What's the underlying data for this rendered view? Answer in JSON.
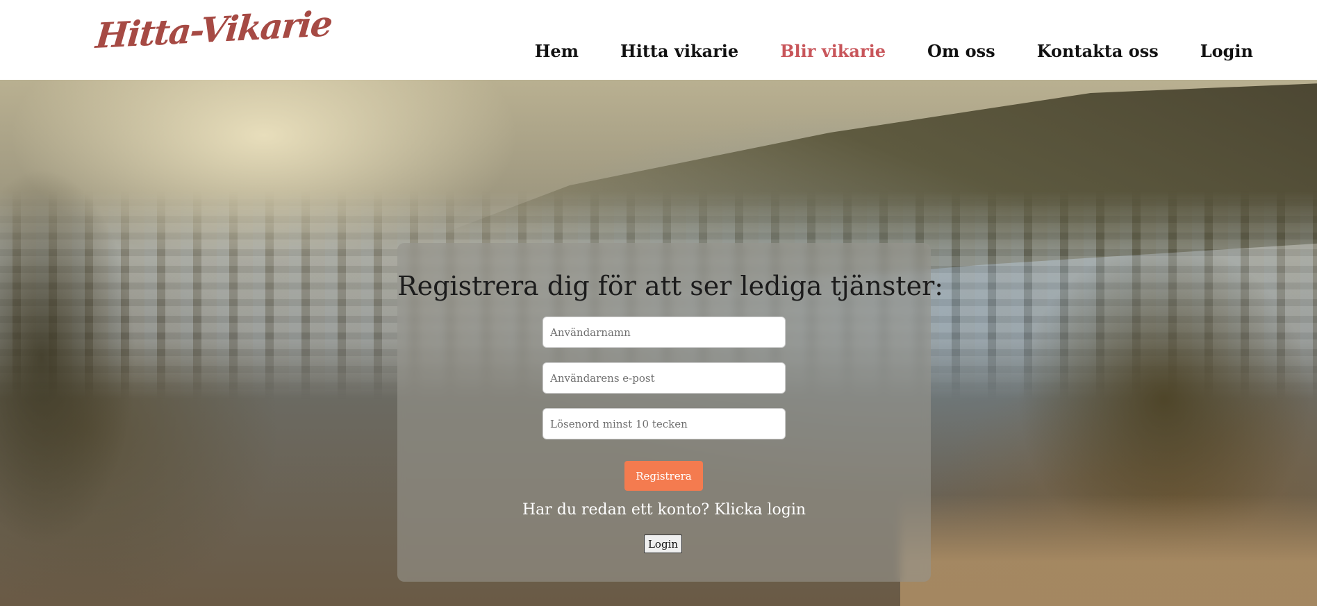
{
  "header": {
    "logo": "Hitta-Vikarie",
    "nav": [
      {
        "label": "Hem"
      },
      {
        "label": "Hitta vikarie"
      },
      {
        "label": "Blir vikarie",
        "active": true
      },
      {
        "label": "Om oss"
      },
      {
        "label": "Kontakta oss"
      },
      {
        "label": "Login"
      }
    ]
  },
  "form": {
    "title": "Registrera dig för att ser lediga tjänster:",
    "username_placeholder": "Användarnamn",
    "email_placeholder": "Användarens e-post",
    "password_placeholder": "Lösenord minst 10 tecken",
    "register_label": "Registrera",
    "already_text": "Har du redan ett konto? Klicka login",
    "login_label": "Login"
  },
  "colors": {
    "logo": "#a64a44",
    "nav_active": "#c8555a",
    "register_button": "#f47b4f"
  }
}
